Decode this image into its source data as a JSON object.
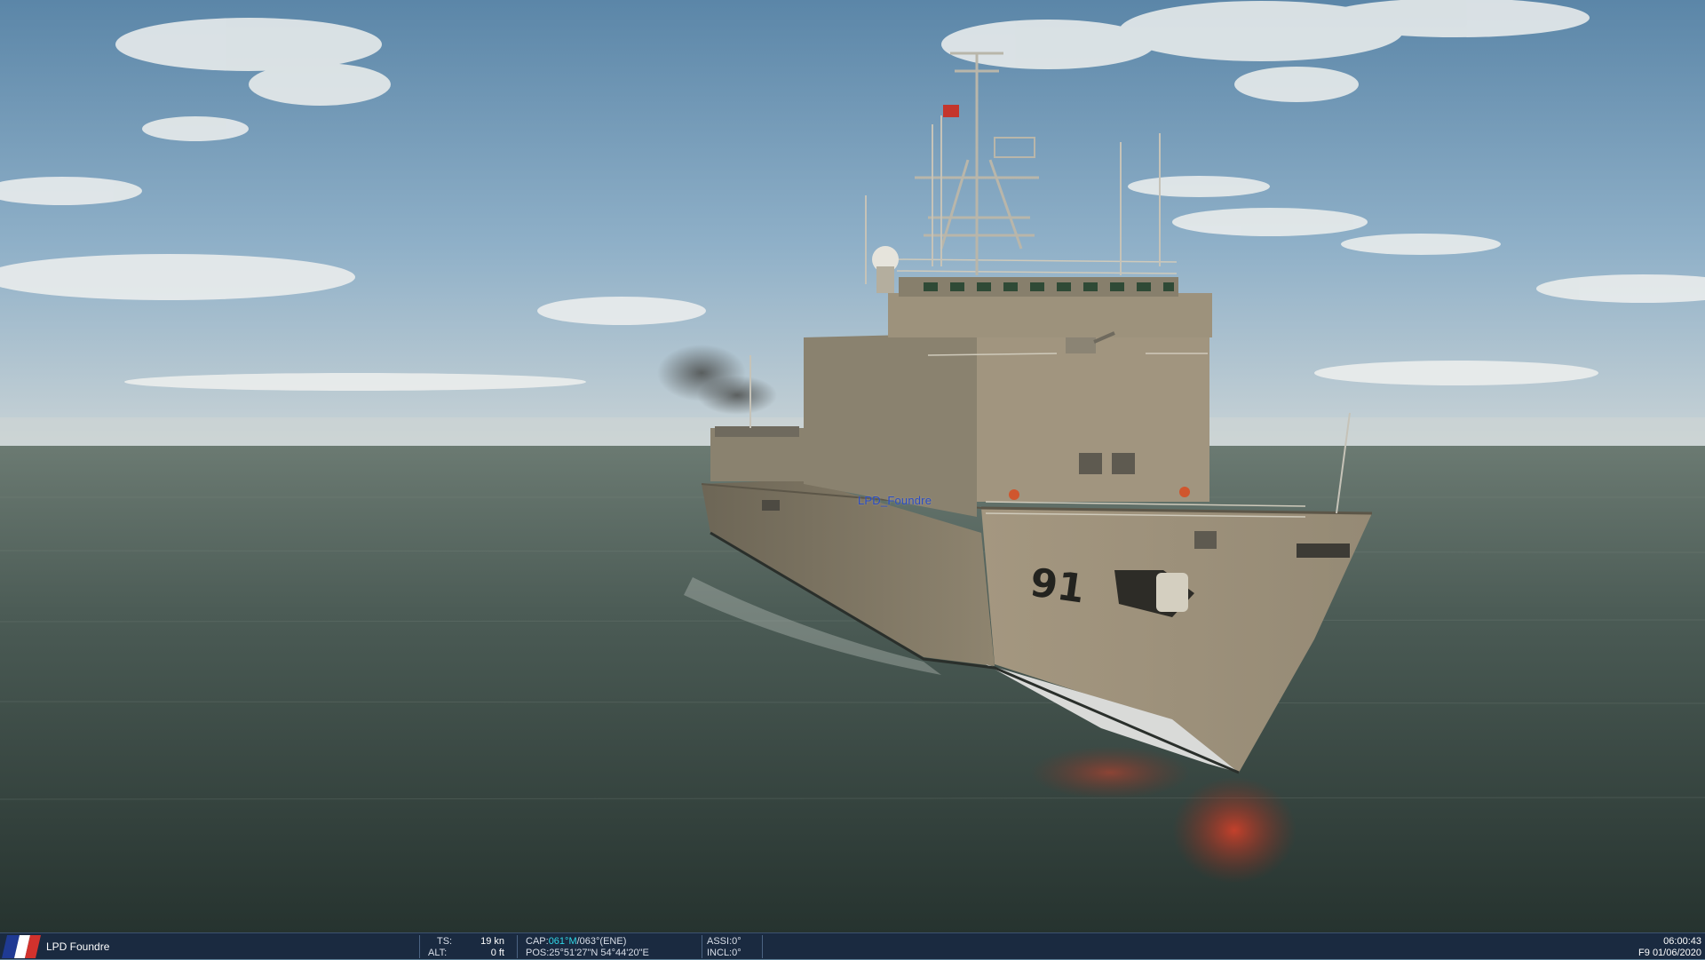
{
  "scene": {
    "unit_label": "LPD_Foundre",
    "hull_number": "91"
  },
  "statusbar": {
    "unit_name": "LPD Foundre",
    "flag_icon": "france-flag-icon",
    "ts_label": "TS:",
    "ts_value": "19 kn",
    "alt_label": "ALT:",
    "alt_value": "0 ft",
    "cap_label": "CAP:",
    "cap_magnetic": "061°M",
    "cap_slash": "/",
    "cap_true": "063°(ENE)",
    "pos_label": "POS:",
    "pos_value": "25°51'27\"N 54°44'20\"E",
    "assi_label": "ASSI:",
    "assi_value": "0°",
    "incl_label": "INCL:",
    "incl_value": "0°",
    "time": "06:00:43",
    "date": "F9 01/06/2020"
  },
  "colors": {
    "accent_cyan": "#30d6e6",
    "statusbar_bg": "#1a2a40",
    "hull": "#9e907a"
  }
}
